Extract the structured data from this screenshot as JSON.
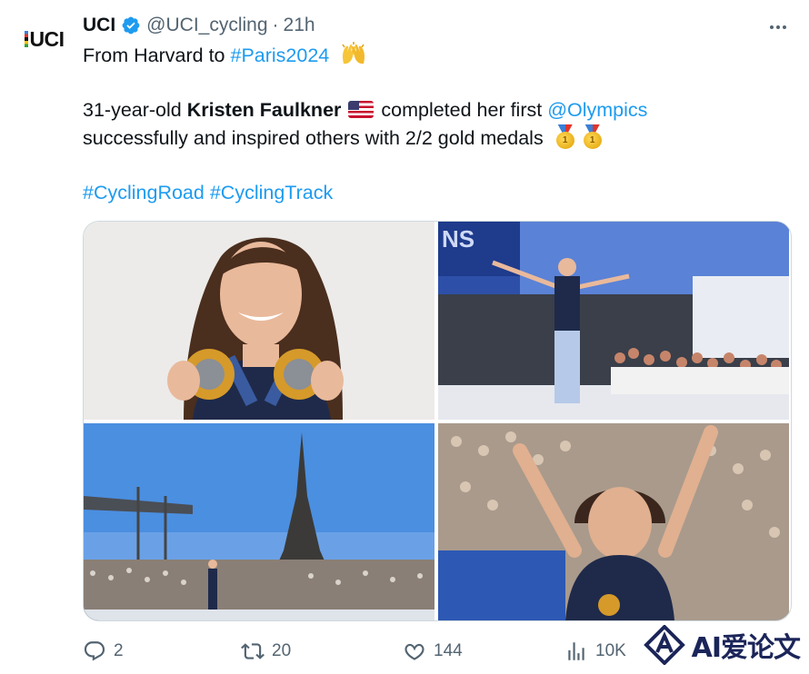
{
  "account": {
    "name": "UCI",
    "handle": "@UCI_cycling",
    "separator": "·",
    "time": "21h",
    "avatar_text": "UCI"
  },
  "more_label": "•••",
  "tweet": {
    "line1_prefix": "From Harvard to ",
    "line1_hashtag": "#Paris2024",
    "line2_prefix": "31-year-old ",
    "line2_bold": "Kristen Faulkner",
    "line2_mid": " completed her first ",
    "line2_mention": "@Olympics",
    "line3": "successfully and inspired others with 2/2 gold medals",
    "hashtag1": "#CyclingRoad",
    "hashtag2": "#CyclingTrack"
  },
  "media": [
    {
      "name": "photo-medals-portrait"
    },
    {
      "name": "photo-stadium-walk"
    },
    {
      "name": "photo-eiffel-tower-crowd"
    },
    {
      "name": "photo-arms-raised-crowd"
    }
  ],
  "actions": {
    "replies": "2",
    "reposts": "20",
    "likes": "144",
    "views": "10K"
  },
  "watermark": {
    "text": "AI爱论文"
  },
  "colors": {
    "link": "#1d9bf0",
    "muted": "#536471",
    "verified": "#1d9bf0",
    "text": "#0f1419"
  }
}
